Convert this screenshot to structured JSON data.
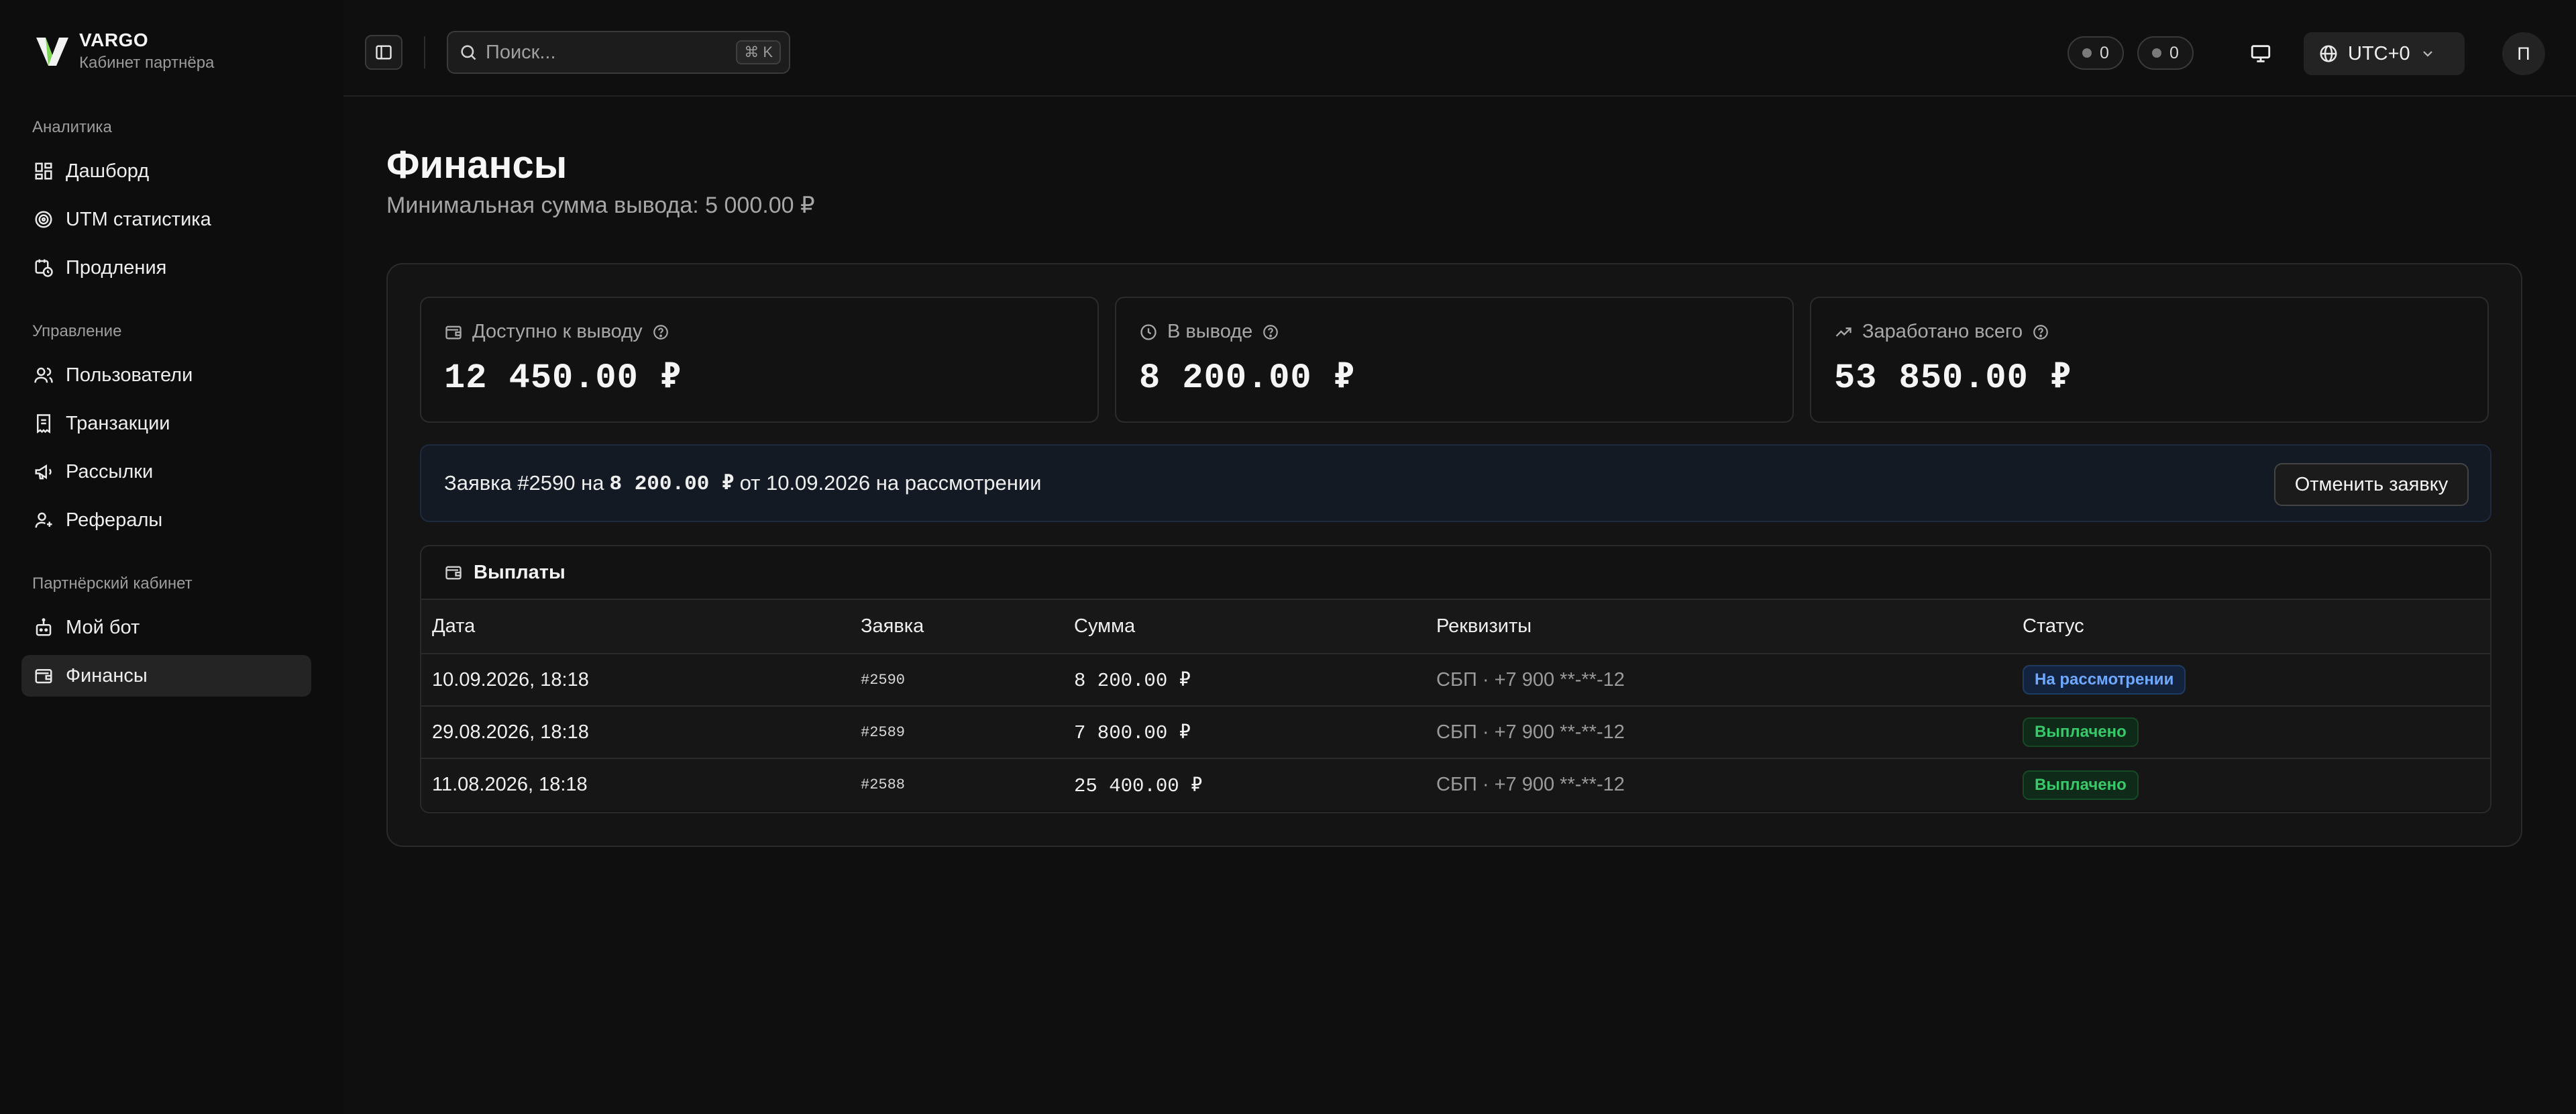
{
  "brand": {
    "name": "VARGO",
    "subtitle": "Кабинет партнёра",
    "accent": "#7ed957"
  },
  "sidebar": {
    "groups": [
      {
        "title": "Аналитика",
        "items": [
          {
            "label": "Дашборд",
            "icon": "dashboard-icon"
          },
          {
            "label": "UTM статистика",
            "icon": "target-icon"
          },
          {
            "label": "Продления",
            "icon": "calendar-clock-icon"
          }
        ]
      },
      {
        "title": "Управление",
        "items": [
          {
            "label": "Пользователи",
            "icon": "users-icon"
          },
          {
            "label": "Транзакции",
            "icon": "receipt-icon"
          },
          {
            "label": "Рассылки",
            "icon": "megaphone-icon"
          },
          {
            "label": "Рефералы",
            "icon": "user-plus-icon"
          }
        ]
      },
      {
        "title": "Партнёрский кабинет",
        "items": [
          {
            "label": "Мой бот",
            "icon": "bot-icon"
          },
          {
            "label": "Финансы",
            "icon": "wallet-icon",
            "active": true
          }
        ]
      }
    ]
  },
  "header": {
    "search_placeholder": "Поиск...",
    "search_shortcut": "⌘ K",
    "counter_a": "0",
    "counter_b": "0",
    "timezone": "UTC+0",
    "avatar_initial": "П"
  },
  "page": {
    "title": "Финансы",
    "subtitle": "Минимальная сумма вывода: 5 000.00 ₽"
  },
  "stats": [
    {
      "label": "Доступно к выводу",
      "value": "12 450.00 ₽",
      "icon": "wallet-icon"
    },
    {
      "label": "В выводе",
      "value": "8 200.00 ₽",
      "icon": "clock-icon"
    },
    {
      "label": "Заработано всего",
      "value": "53 850.00 ₽",
      "icon": "trending-up-icon"
    }
  ],
  "request": {
    "prefix": "Заявка #2590 на",
    "amount": "8 200.00 ₽",
    "suffix": "от 10.09.2026 на рассмотрении",
    "cancel_label": "Отменить заявку"
  },
  "payouts": {
    "title": "Выплаты",
    "columns": [
      "Дата",
      "Заявка",
      "Сумма",
      "Реквизиты",
      "Статус"
    ],
    "rows": [
      {
        "date": "10.09.2026, 18:18",
        "request": "#2590",
        "amount": "8 200.00 ₽",
        "details": "СБП · +7 900 **-**-12",
        "status": "На рассмотрении"
      },
      {
        "date": "29.08.2026, 18:18",
        "request": "#2589",
        "amount": "7 800.00 ₽",
        "details": "СБП · +7 900 **-**-12",
        "status": "Выплачено"
      },
      {
        "date": "11.08.2026, 18:18",
        "request": "#2588",
        "amount": "25 400.00 ₽",
        "details": "СБП · +7 900 **-**-12",
        "status": "Выплачено"
      }
    ]
  }
}
